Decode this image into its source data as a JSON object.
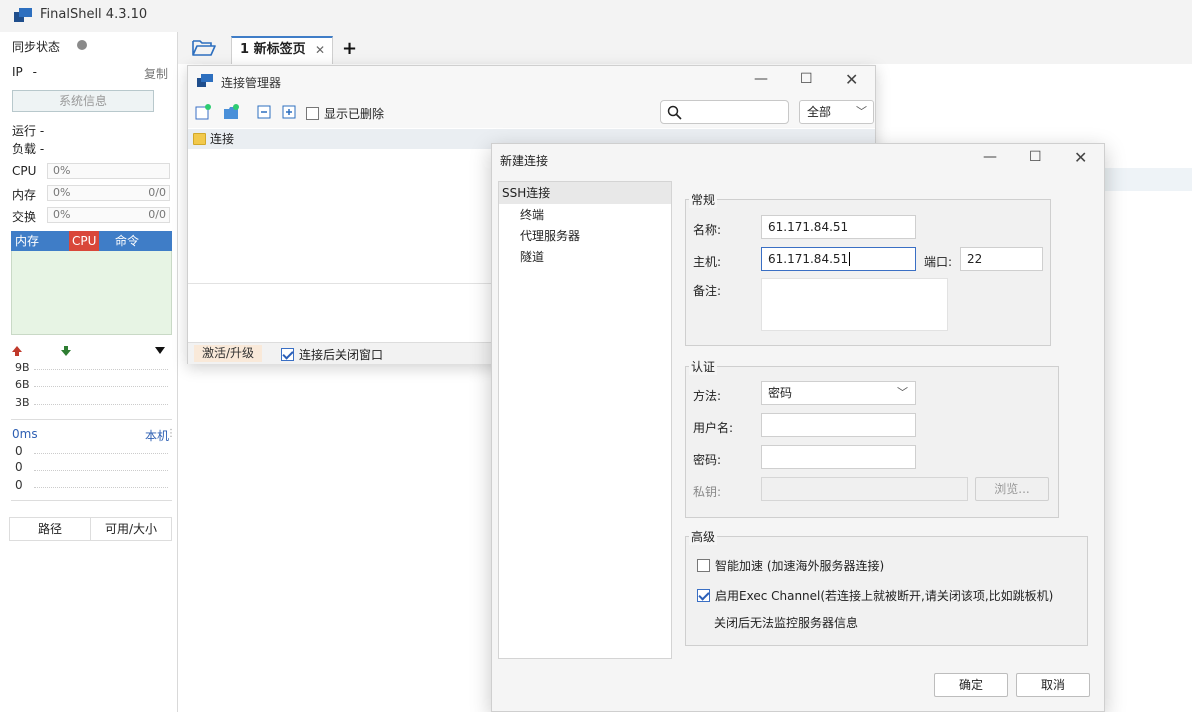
{
  "app": {
    "title": "FinalShell 4.3.10"
  },
  "left_panel": {
    "sync_label": "同步状态",
    "ip_label": "IP",
    "ip_value": "-",
    "copy_label": "复制",
    "sysinfo_button": "系统信息",
    "run_label": "运行 -",
    "load_label": "负载 -",
    "cpu": {
      "label": "CPU",
      "percent": "0%",
      "level": 0
    },
    "mem": {
      "label": "内存",
      "percent": "0%",
      "ratio": "0/0",
      "level": 0
    },
    "swap": {
      "label": "交换",
      "percent": "0%",
      "ratio": "0/0",
      "level": 0
    },
    "proc_columns": [
      "内存",
      "CPU",
      "命令"
    ],
    "net_scale": [
      "9B",
      "6B",
      "3B"
    ],
    "latency_label": "0ms",
    "latency_host": "本机",
    "latency_values": [
      "0",
      "0",
      "0"
    ],
    "path_columns": [
      "路径",
      "可用/大小"
    ],
    "colors": {
      "header_blue": "#3f7dc7",
      "cpu_red": "#d9473a",
      "chart_green": "#e7f4e4",
      "up_arrow": "#c0392b",
      "down_arrow": "#2e7d32"
    }
  },
  "tabs": [
    {
      "label": "1 新标签页"
    }
  ],
  "conn_manager": {
    "title": "连接管理器",
    "show_deleted_label": "显示已删除",
    "show_deleted_checked": false,
    "search_placeholder": "",
    "filter_value": "全部",
    "root_folder": "连接",
    "activate_label": "激活/升级",
    "close_after_label": "连接后关闭窗口",
    "close_after_checked": true
  },
  "new_conn": {
    "title": "新建连接",
    "tree": {
      "selected": "SSH连接",
      "children": [
        "终端",
        "代理服务器",
        "隧道"
      ]
    },
    "general": {
      "title": "常规",
      "name_label": "名称:",
      "name_value": "61.171.84.51",
      "host_label": "主机:",
      "host_value": "61.171.84.51",
      "port_label": "端口:",
      "port_value": "22",
      "remark_label": "备注:",
      "remark_value": ""
    },
    "auth": {
      "title": "认证",
      "method_label": "方法:",
      "method_value": "密码",
      "user_label": "用户名:",
      "user_value": "",
      "pass_label": "密码:",
      "pass_value": "",
      "key_label": "私钥:",
      "key_value": "",
      "browse_label": "浏览..."
    },
    "advanced": {
      "title": "高级",
      "accel_label": "智能加速 (加速海外服务器连接)",
      "accel_checked": false,
      "exec_label": "启用Exec Channel(若连接上就被断开,请关闭该项,比如跳板机)",
      "exec_checked": true,
      "exec_note": "关闭后无法监控服务器信息"
    },
    "ok_label": "确定",
    "cancel_label": "取消"
  }
}
